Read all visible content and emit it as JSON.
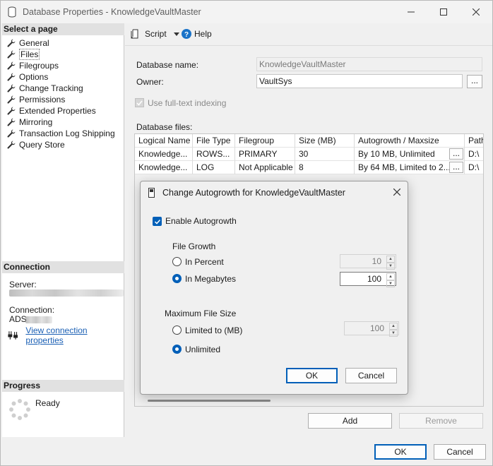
{
  "window": {
    "title": "Database Properties - KnowledgeVaultMaster"
  },
  "sidebar": {
    "select_page_header": "Select a page",
    "pages": [
      {
        "label": "General"
      },
      {
        "label": "Files"
      },
      {
        "label": "Filegroups"
      },
      {
        "label": "Options"
      },
      {
        "label": "Change Tracking"
      },
      {
        "label": "Permissions"
      },
      {
        "label": "Extended Properties"
      },
      {
        "label": "Mirroring"
      },
      {
        "label": "Transaction Log Shipping"
      },
      {
        "label": "Query Store"
      }
    ],
    "selected_page": "Files",
    "connection_header": "Connection",
    "server_label": "Server:",
    "connection_label": "Connection:",
    "connection_value_visible": "ADS",
    "view_connection_link": "View connection properties",
    "progress_header": "Progress",
    "progress_status": "Ready"
  },
  "toolbar": {
    "script_label": "Script",
    "help_label": "Help"
  },
  "form": {
    "database_name_label": "Database name:",
    "database_name_value": "KnowledgeVaultMaster",
    "owner_label": "Owner:",
    "owner_value": "VaultSys",
    "ellipsis": "...",
    "fulltext_label": "Use full-text indexing",
    "database_files_label": "Database files:"
  },
  "files_grid": {
    "columns": [
      "Logical Name",
      "File Type",
      "Filegroup",
      "Size (MB)",
      "Autogrowth / Maxsize",
      "Path"
    ],
    "rows": [
      [
        "Knowledge...",
        "ROWS...",
        "PRIMARY",
        "30",
        "By 10 MB, Unlimited",
        "D:\\"
      ],
      [
        "Knowledge...",
        "LOG",
        "Not Applicable",
        "8",
        "By 64 MB, Limited to 2...",
        "D:\\"
      ]
    ]
  },
  "buttons": {
    "add": "Add",
    "remove": "Remove",
    "ok": "OK",
    "cancel": "Cancel"
  },
  "dialog": {
    "title": "Change Autogrowth for KnowledgeVaultMaster",
    "enable_autogrowth_label": "Enable Autogrowth",
    "enable_autogrowth_checked": true,
    "file_growth_label": "File Growth",
    "in_percent_label": "In Percent",
    "in_percent_value": "10",
    "in_megabytes_label": "In Megabytes",
    "in_megabytes_value": "100",
    "file_growth_selected": "In Megabytes",
    "max_file_size_label": "Maximum File Size",
    "limited_to_label": "Limited to (MB)",
    "limited_to_value": "100",
    "unlimited_label": "Unlimited",
    "max_size_selected": "Unlimited",
    "ok_label": "OK",
    "cancel_label": "Cancel"
  },
  "colors": {
    "accent": "#005fb8",
    "link": "#1a5fb4",
    "section_header": "#e1e1e1"
  }
}
